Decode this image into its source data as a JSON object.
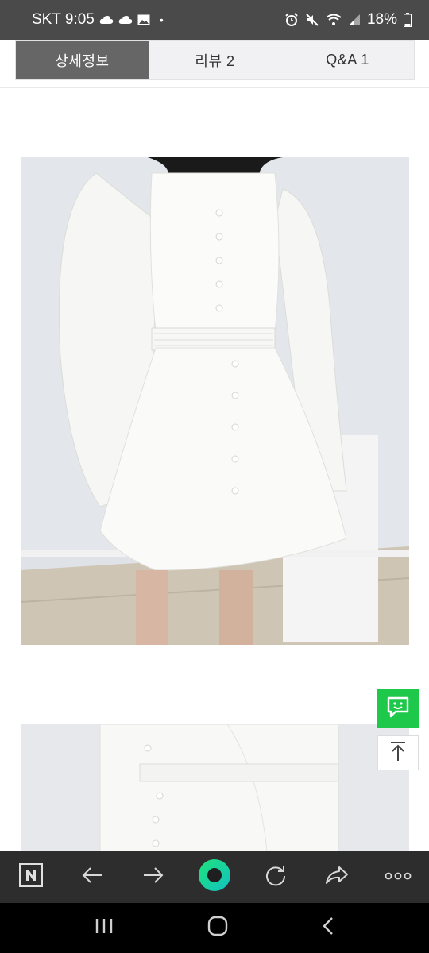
{
  "status": {
    "carrier_time": "SKT 9:05",
    "battery": "18%"
  },
  "tabs": [
    {
      "label": "상세정보",
      "active": true
    },
    {
      "label": "리뷰  2",
      "active": false
    },
    {
      "label": "Q&A  1",
      "active": false
    }
  ],
  "images": {
    "photo1": "white puff-sleeve ruffle dress front view",
    "photo2": "white dress close-up crop"
  },
  "colors": {
    "status_bar": "#4a4a4a",
    "active_tab": "#666666",
    "talk_button": "#1ec84a",
    "toolbar": "#2d2d2d",
    "nav_bar": "#000000"
  },
  "icons": {
    "talk": "chat-bubble-icon",
    "top": "arrow-to-top-icon",
    "toolbar": [
      "naver-home-icon",
      "back-arrow-icon",
      "forward-arrow-icon",
      "green-dot-icon",
      "refresh-icon",
      "share-icon",
      "more-icon"
    ],
    "nav": [
      "recent-apps-icon",
      "home-icon",
      "back-icon"
    ]
  }
}
